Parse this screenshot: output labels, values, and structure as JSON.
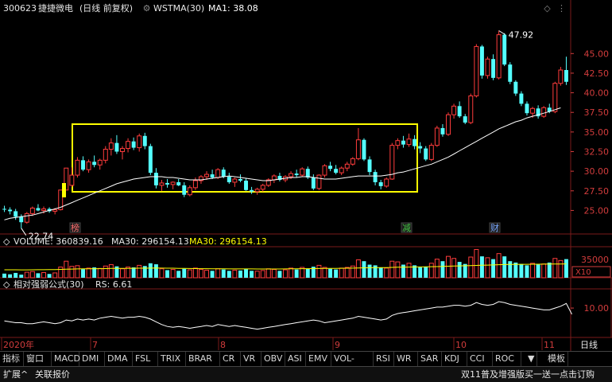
{
  "header": {
    "stock_code": "300623",
    "stock_name": "捷捷微电",
    "period_mode": "(日线 前复权)",
    "indicator": "WSTMA(30)",
    "ma_label": "MA1: 38.08"
  },
  "chart_data": {
    "type": "candlestick",
    "price_ylim": [
      22.0,
      50.0
    ],
    "price_ticks": [
      "45.00",
      "42.50",
      "40.00",
      "37.50",
      "35.00",
      "32.50",
      "30.00",
      "27.50",
      "25.00"
    ],
    "price_tick_values": [
      45,
      42.5,
      40,
      37.5,
      35,
      32.5,
      30,
      27.5,
      25
    ],
    "high_label": "47.92",
    "low_label": "22.74",
    "candles": [
      [
        25.2,
        25.6,
        24.8,
        25.1
      ],
      [
        25.1,
        25.4,
        24.5,
        24.9
      ],
      [
        24.9,
        25.2,
        23.8,
        24.2
      ],
      [
        24.2,
        24.5,
        22.74,
        23.5
      ],
      [
        23.5,
        24.8,
        23.3,
        24.6
      ],
      [
        24.6,
        25.5,
        24.3,
        25.3
      ],
      [
        25.3,
        25.8,
        24.9,
        25.0
      ],
      [
        25.0,
        25.5,
        24.6,
        25.2
      ],
      [
        25.2,
        25.4,
        24.7,
        24.9
      ],
      [
        24.9,
        25.3,
        24.5,
        25.1
      ],
      [
        25.1,
        27.6,
        25.0,
        27.6
      ],
      [
        27.6,
        30.4,
        27.6,
        30.4
      ],
      [
        28.2,
        30.5,
        28.0,
        29.5
      ],
      [
        29.5,
        31.8,
        29.2,
        31.4
      ],
      [
        31.4,
        31.9,
        30.0,
        30.2
      ],
      [
        30.2,
        31.5,
        29.8,
        31.2
      ],
      [
        31.2,
        32.0,
        30.5,
        30.8
      ],
      [
        30.8,
        31.6,
        30.2,
        31.4
      ],
      [
        31.4,
        33.2,
        31.0,
        32.8
      ],
      [
        32.8,
        34.2,
        32.0,
        33.6
      ],
      [
        33.6,
        34.6,
        32.2,
        32.5
      ],
      [
        32.5,
        33.2,
        31.5,
        32.9
      ],
      [
        32.9,
        34.2,
        32.4,
        33.8
      ],
      [
        33.8,
        34.3,
        32.7,
        33.0
      ],
      [
        33.0,
        34.8,
        32.5,
        34.5
      ],
      [
        34.5,
        34.9,
        32.8,
        33.2
      ],
      [
        33.2,
        33.5,
        29.5,
        29.8
      ],
      [
        29.8,
        30.4,
        27.8,
        28.2
      ],
      [
        28.2,
        28.9,
        27.5,
        28.5
      ],
      [
        28.5,
        29.0,
        27.9,
        28.3
      ],
      [
        28.3,
        28.7,
        27.7,
        28.6
      ],
      [
        28.6,
        29.0,
        28.1,
        28.2
      ],
      [
        28.2,
        28.6,
        26.7,
        27.0
      ],
      [
        27.0,
        28.2,
        26.8,
        27.9
      ],
      [
        27.9,
        29.2,
        27.6,
        28.8
      ],
      [
        28.8,
        29.5,
        28.4,
        29.3
      ],
      [
        29.3,
        30.0,
        28.9,
        29.6
      ],
      [
        29.6,
        30.2,
        29.0,
        29.2
      ],
      [
        29.2,
        30.4,
        29.0,
        30.2
      ],
      [
        30.2,
        30.5,
        29.1,
        29.3
      ],
      [
        29.3,
        29.8,
        28.4,
        28.6
      ],
      [
        28.6,
        29.2,
        28.0,
        29.0
      ],
      [
        29.0,
        29.6,
        28.6,
        28.8
      ],
      [
        28.8,
        29.1,
        27.5,
        27.6
      ],
      [
        27.6,
        28.0,
        27.1,
        27.4
      ],
      [
        27.4,
        27.9,
        27.0,
        27.7
      ],
      [
        27.7,
        28.4,
        27.4,
        28.2
      ],
      [
        28.2,
        29.1,
        28.0,
        28.9
      ],
      [
        28.9,
        29.6,
        28.5,
        29.4
      ],
      [
        29.4,
        29.8,
        28.7,
        28.9
      ],
      [
        28.9,
        29.5,
        28.6,
        29.3
      ],
      [
        29.3,
        30.0,
        29.0,
        29.7
      ],
      [
        29.7,
        30.2,
        29.2,
        29.5
      ],
      [
        29.5,
        30.5,
        29.3,
        30.3
      ],
      [
        30.3,
        30.6,
        29.0,
        29.2
      ],
      [
        29.2,
        29.6,
        27.6,
        27.8
      ],
      [
        27.8,
        29.6,
        27.6,
        29.5
      ],
      [
        29.5,
        30.9,
        29.2,
        30.7
      ],
      [
        30.7,
        31.2,
        30.0,
        30.3
      ],
      [
        30.3,
        30.8,
        29.6,
        29.8
      ],
      [
        29.8,
        30.6,
        29.5,
        30.4
      ],
      [
        30.4,
        31.2,
        30.0,
        30.9
      ],
      [
        30.9,
        31.8,
        30.7,
        31.6
      ],
      [
        31.6,
        35.5,
        31.4,
        34.0
      ],
      [
        34.0,
        34.2,
        31.3,
        31.5
      ],
      [
        31.5,
        31.9,
        29.5,
        29.9
      ],
      [
        29.9,
        30.2,
        28.2,
        28.6
      ],
      [
        28.6,
        28.9,
        27.7,
        28.1
      ],
      [
        28.1,
        29.2,
        27.9,
        29.0
      ],
      [
        29.0,
        33.6,
        28.9,
        33.3
      ],
      [
        33.3,
        34.2,
        32.8,
        33.9
      ],
      [
        33.9,
        34.5,
        33.0,
        33.4
      ],
      [
        33.4,
        34.8,
        33.1,
        34.1
      ],
      [
        34.1,
        34.6,
        32.8,
        33.2
      ],
      [
        33.2,
        33.7,
        32.3,
        32.9
      ],
      [
        32.9,
        33.2,
        31.3,
        31.5
      ],
      [
        31.5,
        33.6,
        31.3,
        33.3
      ],
      [
        33.3,
        35.8,
        33.1,
        35.5
      ],
      [
        35.5,
        36.0,
        34.4,
        34.7
      ],
      [
        34.7,
        37.5,
        34.5,
        37.2
      ],
      [
        37.2,
        38.6,
        36.7,
        38.3
      ],
      [
        38.3,
        38.9,
        36.8,
        37.0
      ],
      [
        37.0,
        37.3,
        36.0,
        36.2
      ],
      [
        36.2,
        39.9,
        36.0,
        39.6
      ],
      [
        39.6,
        46.2,
        39.4,
        45.9
      ],
      [
        45.9,
        46.1,
        41.8,
        42.2
      ],
      [
        42.2,
        44.6,
        41.8,
        44.3
      ],
      [
        44.3,
        44.9,
        41.6,
        41.9
      ],
      [
        41.9,
        47.92,
        41.7,
        47.4
      ],
      [
        47.4,
        47.6,
        43.4,
        43.6
      ],
      [
        43.6,
        43.9,
        41.1,
        41.4
      ],
      [
        41.4,
        41.6,
        39.6,
        39.9
      ],
      [
        39.9,
        40.2,
        38.3,
        38.6
      ],
      [
        38.6,
        38.9,
        37.1,
        37.4
      ],
      [
        37.4,
        38.2,
        36.8,
        38.0
      ],
      [
        38.0,
        38.4,
        36.7,
        37.0
      ],
      [
        37.0,
        38.3,
        36.8,
        38.1
      ],
      [
        38.1,
        38.6,
        37.4,
        37.6
      ],
      [
        37.6,
        41.4,
        37.4,
        41.2
      ],
      [
        41.2,
        43.3,
        40.9,
        42.9
      ],
      [
        42.9,
        44.6,
        41.0,
        41.4
      ]
    ],
    "ma_values": [
      23.8,
      24.0,
      24.1,
      24.2,
      24.3,
      24.4,
      24.6,
      24.8,
      25.0,
      25.2,
      25.4,
      25.7,
      26.0,
      26.3,
      26.6,
      26.9,
      27.2,
      27.5,
      27.8,
      28.1,
      28.4,
      28.6,
      28.8,
      29.0,
      29.1,
      29.2,
      29.3,
      29.3,
      29.3,
      29.2,
      29.2,
      29.1,
      29.0,
      28.9,
      28.9,
      28.9,
      29.0,
      29.1,
      29.2,
      29.3,
      29.4,
      29.3,
      29.2,
      29.1,
      29.0,
      28.9,
      28.8,
      28.8,
      28.9,
      29.0,
      29.1,
      29.2,
      29.2,
      29.3,
      29.3,
      29.2,
      29.1,
      29.0,
      29.0,
      29.0,
      29.1,
      29.2,
      29.3,
      29.4,
      29.4,
      29.4,
      29.4,
      29.4,
      29.5,
      29.6,
      29.8,
      29.9,
      30.1,
      30.3,
      30.5,
      30.7,
      30.9,
      31.2,
      31.5,
      31.8,
      32.2,
      32.6,
      33.0,
      33.4,
      33.8,
      34.2,
      34.6,
      35.0,
      35.4,
      35.7,
      36.0,
      36.3,
      36.5,
      36.8,
      37.0,
      37.2,
      37.4,
      37.6,
      37.85,
      38.08
    ],
    "volume": {
      "label": "VOLUME: 360839.16",
      "ma_label": "MA30: 296154.13",
      "ma_label2": "MA30: 296154.13",
      "tick": "35000",
      "unit": "X10",
      "values": [
        120,
        100,
        140,
        90,
        160,
        180,
        130,
        150,
        110,
        140,
        310,
        480,
        330,
        350,
        250,
        280,
        300,
        270,
        340,
        380,
        330,
        260,
        310,
        300,
        360,
        340,
        420,
        390,
        260,
        220,
        240,
        200,
        260,
        230,
        280,
        240,
        220,
        200,
        260,
        240,
        200,
        220,
        210,
        250,
        200,
        190,
        210,
        260,
        240,
        200,
        230,
        280,
        240,
        300,
        260,
        320,
        360,
        300,
        260,
        240,
        280,
        300,
        340,
        520,
        480,
        380,
        360,
        300,
        280,
        480,
        460,
        380,
        420,
        360,
        300,
        320,
        420,
        540,
        480,
        620,
        560,
        460,
        400,
        600,
        820,
        620,
        580,
        540,
        700,
        620,
        480,
        440,
        400,
        360,
        420,
        380,
        400,
        440,
        560,
        500,
        540
      ],
      "ma_values": [
        230,
        230,
        230,
        228,
        228,
        230,
        232,
        234,
        236,
        238,
        242,
        248,
        252,
        256,
        258,
        260,
        262,
        264,
        266,
        270,
        272,
        272,
        272,
        274,
        276,
        278,
        280,
        282,
        280,
        278,
        276,
        272,
        270,
        268,
        266,
        264,
        262,
        260,
        260,
        258,
        256,
        256,
        256,
        256,
        256,
        254,
        254,
        254,
        254,
        254,
        256,
        258,
        260,
        262,
        264,
        266,
        268,
        270,
        270,
        272,
        274,
        276,
        280,
        284,
        288,
        290,
        292,
        294,
        296,
        300,
        304,
        306,
        310,
        312,
        314,
        316,
        320,
        324,
        328,
        334,
        340,
        344,
        348,
        352,
        358,
        364,
        368,
        372,
        378,
        384,
        386,
        388,
        390,
        390,
        392,
        392,
        394,
        396,
        398,
        400,
        402
      ]
    },
    "rs": {
      "label": "相对强弱公式(30)",
      "value_label": "RS: 6.61",
      "tick": "10.00",
      "ylim": [
        -6,
        20
      ],
      "values": [
        3,
        2.5,
        2,
        2,
        1.5,
        1.5,
        2,
        2.5,
        2,
        1.5,
        2,
        3.5,
        3,
        4,
        3.5,
        4,
        3.5,
        4.5,
        5,
        5.5,
        5,
        4.5,
        5,
        5,
        5.5,
        5,
        4,
        2.5,
        1,
        0,
        -0.5,
        0,
        -0.5,
        -1,
        -0.5,
        0,
        0.5,
        0,
        1,
        0.5,
        0,
        0.5,
        0,
        -0.5,
        -1,
        -1.5,
        -1,
        -0.5,
        0,
        0.5,
        1,
        1.5,
        2,
        2.5,
        3,
        3.5,
        3,
        2,
        2.5,
        3,
        3.5,
        4,
        4.5,
        5.5,
        5,
        4.5,
        4,
        3.5,
        4,
        6,
        7,
        7.5,
        8,
        8.5,
        9,
        9.5,
        10,
        10.5,
        10.5,
        11,
        11.5,
        11.5,
        11,
        11.5,
        13,
        12,
        11.5,
        12,
        13.5,
        13,
        12,
        11.5,
        11,
        10.5,
        10,
        9.5,
        9,
        9,
        10,
        11,
        12.5,
        6.61
      ]
    },
    "markers": [
      {
        "text": "榜",
        "color": "#ff7070"
      },
      {
        "text": "减",
        "color": "#46c846"
      },
      {
        "text": "财",
        "color": "#7aa8ff"
      }
    ],
    "months": [
      "2020年",
      "7",
      "8",
      "9",
      "10",
      "11"
    ],
    "period_right": "日线"
  },
  "tabs": [
    "指标",
    "窗口",
    "MACD",
    "DMI",
    "DMA",
    "FSL",
    "TRIX",
    "BRAR",
    "CR",
    "VR",
    "OBV",
    "ASI",
    "EMV",
    "VOL-TDX",
    "RSI",
    "WR",
    "SAR",
    "KDJ",
    "CCI",
    "ROC"
  ],
  "tab_arrow": "▼",
  "tab_template": "模板",
  "bottom": {
    "expand": "扩展^",
    "related": "关联报价",
    "promo": "双11普及增强版买一送一点击订购"
  },
  "colors": {
    "up": "#ff3c3c",
    "down": "#54ffff",
    "ma": "#ffffff",
    "vol_ma": "#ffff00",
    "box": "#ffff00",
    "grid": "#7a1a1a",
    "axis_text": "#d23c3c"
  }
}
